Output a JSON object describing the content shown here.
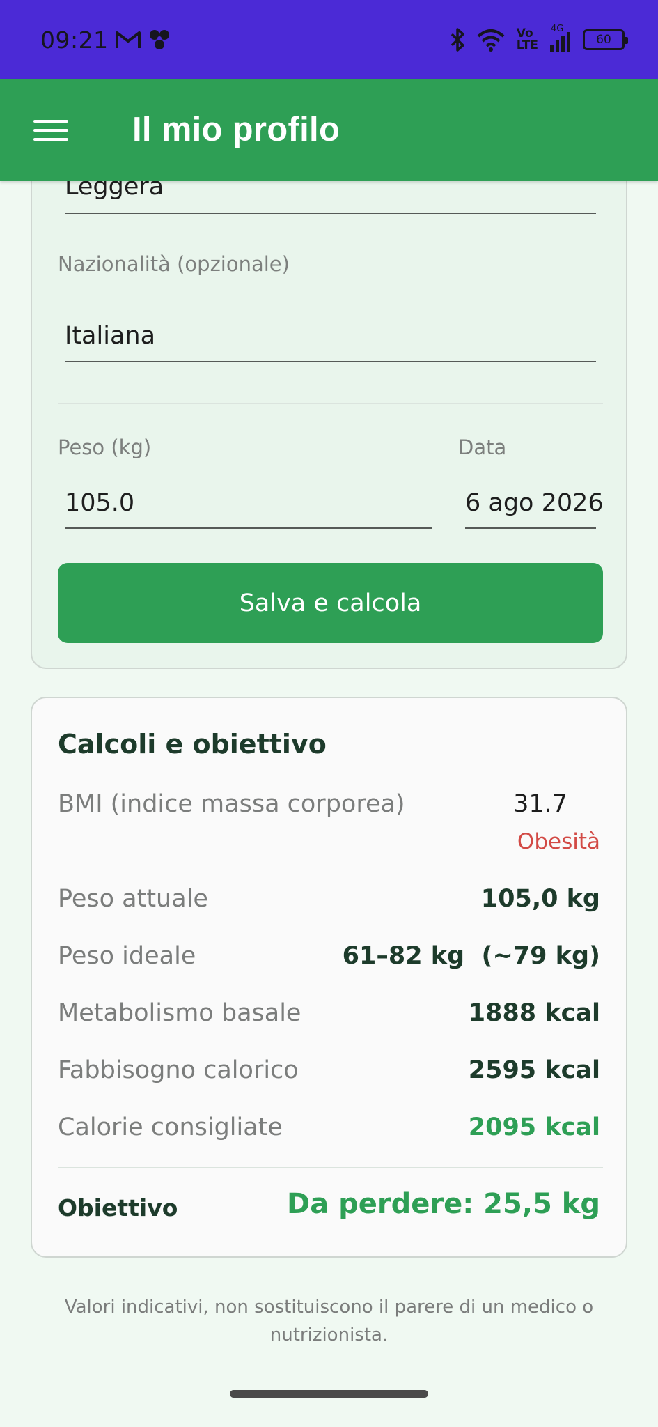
{
  "status_bar": {
    "time": "09:21",
    "network_top": "Vo",
    "network_bottom": "LTE",
    "signal_label": "4G",
    "battery": "60"
  },
  "app_bar": {
    "title": "Il mio profilo"
  },
  "profile": {
    "activity_value": "Leggera",
    "nationality_label": "Nazionalità (opzionale)",
    "nationality_value": "Italiana",
    "weight_label": "Peso (kg)",
    "weight_value": "105.0",
    "date_label": "Data",
    "date_value": "6 ago 2026",
    "save_button": "Salva e calcola"
  },
  "calc": {
    "title": "Calcoli e obiettivo",
    "bmi_label": "BMI (indice massa corporea)",
    "bmi_value": "31.7",
    "bmi_category": "Obesità",
    "current_weight_label": "Peso attuale",
    "current_weight_value": "105,0 kg",
    "ideal_weight_label": "Peso ideale",
    "ideal_weight_value": "61–82 kg  (~79 kg)",
    "bmr_label": "Metabolismo basale",
    "bmr_value": "1888 kcal",
    "needs_label": "Fabbisogno calorico",
    "needs_value": "2595 kcal",
    "recommended_label": "Calorie consigliate",
    "recommended_value": "2095 kcal",
    "goal_label": "Obiettivo",
    "goal_value": "Da perdere: 25,5 kg"
  },
  "disclaimer": "Valori indicativi, non sostituiscono il parere di un medico o nutrizionista.",
  "colors": {
    "status_bar": "#4b2ad6",
    "primary": "#2e9f55",
    "warning": "#d24a45",
    "background": "#f0f9f2"
  }
}
